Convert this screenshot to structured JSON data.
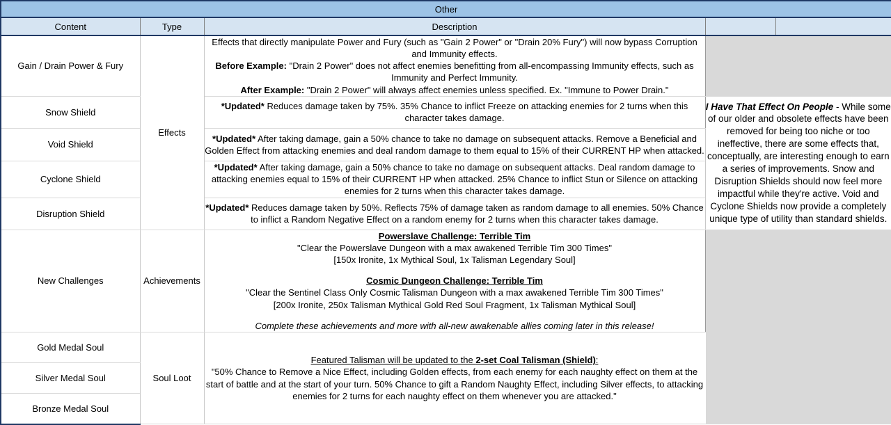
{
  "header": {
    "title": "Other",
    "columns": [
      "Content",
      "Type",
      "Description",
      "",
      ""
    ]
  },
  "note_panel": {
    "title": "I Have That Effect On People",
    "separator": " - ",
    "body": "While some of our older and obsolete effects have been removed for being too niche or too ineffective, there are some effects that, conceptually, are interesting enough to earn a series of improvements. Snow and Disruption Shields should now feel more impactful while they're active. Void and Cyclone Shields now provide a completely unique type of utility than standard shields."
  },
  "rows": {
    "content": [
      "Gain / Drain Power & Fury",
      "Snow Shield",
      "Void Shield",
      "Cyclone Shield",
      "Disruption Shield",
      "New Challenges",
      "Gold Medal Soul",
      "Silver Medal Soul",
      "Bronze Medal Soul"
    ],
    "types": {
      "effects": "Effects",
      "achievements": "Achievements",
      "soul_loot": "Soul Loot"
    }
  },
  "descriptions": {
    "power_fury": {
      "line1": "Effects that directly manipulate Power and Fury (such as \"Gain 2 Power\" or \"Drain 20% Fury\") will now bypass Corruption and Immunity effects.",
      "before_label": "Before Example:",
      "before_text": " \"Drain 2 Power\" does not affect enemies benefitting from all-encompassing Immunity effects, such as Immunity and Perfect Immunity.",
      "after_label": "After Example:",
      "after_text": " \"Drain 2 Power\" will always affect enemies unless specified. Ex. \"Immune to Power Drain.\""
    },
    "snow_shield": {
      "tag": "*Updated*",
      "text": " Reduces damage taken by 75%. 35% Chance to inflict Freeze on attacking enemies for 2 turns when this character takes damage."
    },
    "void_shield": {
      "tag": "*Updated*",
      "text": " After taking damage, gain a 50% chance to take no damage on subsequent attacks. Remove a Beneficial and Golden Effect from attacking enemies and deal random damage to them equal to 15% of their CURRENT HP when attacked."
    },
    "cyclone_shield": {
      "tag": "*Updated*",
      "text": " After taking damage, gain a 50% chance to take no damage on subsequent attacks. Deal random damage to attacking enemies equal to 15% of their CURRENT HP when attacked. 25% Chance to inflict Stun or Silence on attacking enemies for 2 turns when this character takes damage."
    },
    "disruption_shield": {
      "tag": "*Updated*",
      "text": " Reduces damage taken by 50%. Reflects 75% of damage taken as random damage to all enemies. 50% Chance to inflict a Random Negative Effect on a random enemy for 2 turns when this character takes damage."
    },
    "new_challenges": {
      "challenge1_title": "Powerslave Challenge: Terrible Tim",
      "challenge1_objective": "\"Clear the Powerslave Dungeon with a max awakened Terrible Tim 300 Times\"",
      "challenge1_rewards": "[150x Ironite, 1x Mythical Soul, 1x Talisman Legendary Soul]",
      "challenge2_title": "Cosmic Dungeon Challenge: Terrible Tim",
      "challenge2_objective": "\"Clear the Sentinel Class Only Cosmic Talisman Dungeon with a max awakened Terrible Tim 300 Times\"",
      "challenge2_rewards": "[200x Ironite, 250x Talisman Mythical Gold Red Soul Fragment, 1x Talisman Mythical Soul]",
      "footer": "Complete these achievements and more with all-new awakenable allies coming later in this release!"
    },
    "soul_loot": {
      "heading_prefix": "Featured Talisman will be updated to the ",
      "heading_bold": "2-set Coal Talisman (Shield)",
      "heading_suffix": ":",
      "body": "\"50% Chance to Remove a Nice Effect, including Golden effects, from each enemy for each naughty effect on them at the start of battle and at the start of your turn. 50% Chance to gift a Random Naughty Effect, including Silver effects, to attacking enemies for 2 turns for each naughty effect on them whenever you are attacked.\""
    }
  },
  "colors": {
    "header_top_bg": "#9dc3e6",
    "header_sub_bg": "#d6e4f2",
    "gray_fill": "#d9d9d9",
    "outer_border": "#1f3864",
    "grid_line": "#d9d9d9"
  }
}
